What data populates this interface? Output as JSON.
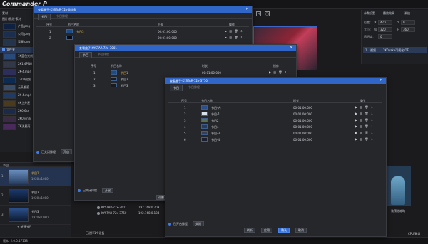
{
  "app": {
    "logo": "Commander P",
    "version": "版本: 2.0.0.17138"
  },
  "left_panel": {
    "header": "素材",
    "subheader": "图片/视频-素材",
    "folder": "文件夹",
    "items": [
      "产品.png",
      "公司.png",
      "背景.png",
      "1K蓝色光线",
      "2K1.4PNG",
      "2K-4.mp4",
      "720P视频",
      "云朵翻滚",
      "2K-4.mp4",
      "4K上升星",
      "2K0.6ss",
      "2K0ysnfk",
      "ZK流星雨"
    ]
  },
  "programs": {
    "header": "节目",
    "items": [
      {
        "num": "1",
        "name": "节目1",
        "res": "1920×1080",
        "selected": true
      },
      {
        "num": "2",
        "name": "节目2",
        "res": "1920×1080",
        "selected": false
      },
      {
        "num": "3",
        "name": "节目3",
        "res": "1920×1080",
        "selected": false
      }
    ],
    "add": "+ 新建节目"
  },
  "right_panel": {
    "tabs": [
      "参数设置",
      "播放效果",
      "系统"
    ],
    "position_label": "位置：",
    "x_label": "X",
    "x_value": "470",
    "y_label": "Y",
    "y_value": "0",
    "size_label": "大小：",
    "w_label": "W",
    "w_value": "320",
    "h_label": "H",
    "h_value": "360",
    "opacity_label": "透明度：",
    "opacity_value": "0",
    "row_num": "1",
    "row_type": "视频",
    "row_name": "2K0yake可视化 OF..."
  },
  "preview": {
    "hint": "该预览缩略",
    "status": "CPU/磁盘"
  },
  "dialog1": {
    "title": "查看盒子-KYSTAR-72x-0808",
    "tab_active": "节目",
    "tab_other": "节目排程",
    "headers": [
      "序号",
      "节目名称",
      "时长",
      "操作"
    ],
    "rows": [
      {
        "num": "1",
        "name": "节目3",
        "duration": "00:01:00:000"
      },
      {
        "num": "2",
        "name": "",
        "duration": "00:01:00:000"
      }
    ],
    "schedule_label": "已关闭排程",
    "schedule_btn": "开启"
  },
  "dialog2": {
    "title": "查看盒子-KYSTAR-72x-3001",
    "tab_active": "节目",
    "tab_other": "节目排程",
    "headers": [
      "序号",
      "节目名称",
      "时长",
      "操作"
    ],
    "rows": [
      {
        "num": "1",
        "name": "节目1",
        "duration": "00:01:00:000"
      },
      {
        "num": "2",
        "name": "节目2",
        "duration": "00:01:00:000"
      },
      {
        "num": "3",
        "name": "节目3",
        "duration": "00:01:00:000"
      }
    ],
    "schedule_label": "已关闭排程",
    "schedule_btn": "开启",
    "partial_btn": "调整",
    "devices": [
      {
        "name": "KYSTAR-72x-3001",
        "ip": "192.168.0.209"
      },
      {
        "name": "KYSTAR-72x-3750",
        "ip": "192.168.0.184"
      }
    ],
    "selected_count": "已选择1个设备"
  },
  "dialog3": {
    "title": "查看盒子-KYSTAR-72x-3750",
    "tab_active": "节目",
    "tab_other": "节目排程",
    "headers": [
      "序号",
      "节目名称",
      "时长",
      "操作"
    ],
    "rows": [
      {
        "num": "1",
        "name": "节目-内",
        "duration": "00:01:00:000"
      },
      {
        "num": "2",
        "name": "节目-1",
        "duration": "00:01:00:000"
      },
      {
        "num": "3",
        "name": "节目2",
        "duration": "00:01:00:000"
      },
      {
        "num": "4",
        "name": "节目4",
        "duration": "00:01:00:000"
      },
      {
        "num": "5",
        "name": "节目-3",
        "duration": "00:01:00:000"
      },
      {
        "num": "6",
        "name": "节目-4",
        "duration": "00:01:00:000"
      }
    ],
    "ops": "▶ ▥ 🗑 ⇩",
    "schedule_label": "已开启排程",
    "schedule_btn": "关闭",
    "buttons": [
      "刷新",
      "应用",
      "确认",
      "取消"
    ]
  },
  "colors": {
    "accent": "#2f66c8",
    "selected_row": "#24334f",
    "highlight_text": "#e6b94a"
  }
}
